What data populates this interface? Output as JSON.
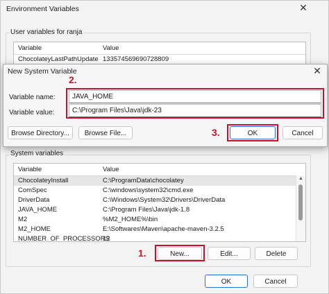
{
  "env": {
    "title": "Environment Variables",
    "user_group_label": "User variables for ranja",
    "user_headers": [
      "Variable",
      "Value"
    ],
    "user_rows": [
      {
        "variable": "ChocolateyLastPathUpdate",
        "value": "133574569690728809"
      }
    ],
    "system_group_label": "System variables",
    "system_headers": [
      "Variable",
      "Value"
    ],
    "system_rows": [
      {
        "variable": "ChocolateyInstall",
        "value": "C:\\ProgramData\\chocolatey"
      },
      {
        "variable": "ComSpec",
        "value": "C:\\windows\\system32\\cmd.exe"
      },
      {
        "variable": "DriverData",
        "value": "C:\\Windows\\System32\\Drivers\\DriverData"
      },
      {
        "variable": "JAVA_HOME",
        "value": "C:\\Program Files\\Java\\jdk-1.8"
      },
      {
        "variable": "M2",
        "value": "%M2_HOME%\\bin"
      },
      {
        "variable": "M2_HOME",
        "value": "E:\\Softwares\\Maven\\apache-maven-3.2.5"
      },
      {
        "variable": "NUMBER_OF_PROCESSORS",
        "value": "12"
      }
    ],
    "new_label": "New...",
    "edit_label": "Edit...",
    "delete_label": "Delete",
    "ok_label": "OK",
    "cancel_label": "Cancel"
  },
  "dialog": {
    "title": "New System Variable",
    "name_label": "Variable name:",
    "name_value": "JAVA_HOME",
    "value_label": "Variable value:",
    "value_value": "C:\\Program Files\\Java\\jdk-23",
    "browse_dir_label": "Browse Directory...",
    "browse_file_label": "Browse File...",
    "ok_label": "OK",
    "cancel_label": "Cancel"
  },
  "steps": {
    "step1": "1.",
    "step2": "2.",
    "step3": "3."
  },
  "colors": {
    "annotation_red": "#c8102e",
    "primary_blue": "#2a6fd3"
  },
  "icons": {
    "close": "close-icon"
  }
}
